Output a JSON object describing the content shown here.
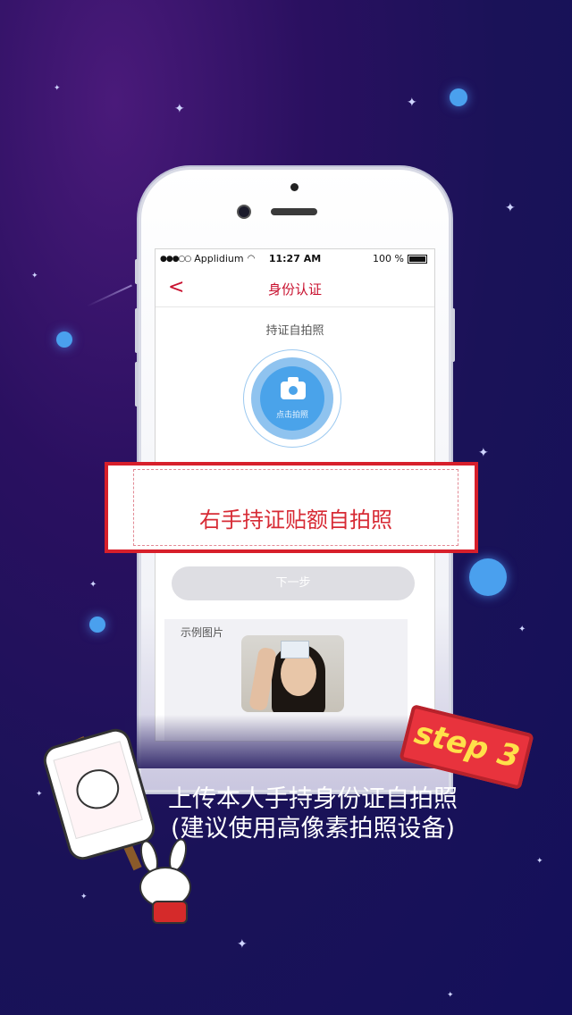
{
  "status_bar": {
    "carrier": "Applidium",
    "time": "11:27 AM",
    "battery": "100 %"
  },
  "nav": {
    "back_label": "<",
    "title": "身份认证"
  },
  "section": {
    "title": "持证自拍照"
  },
  "capture": {
    "label": "点击拍照"
  },
  "buttons": {
    "next": "下一步"
  },
  "example": {
    "title": "示例图片"
  },
  "callout": {
    "text": "右手持证贴额自拍照"
  },
  "captions": {
    "line1": "上传本人手持身份证自拍照",
    "line2": "(建议使用高像素拍照设备)"
  },
  "badge": {
    "text": "step 3"
  },
  "colors": {
    "accent_red": "#c8102e",
    "capture_blue": "#4aa3ea",
    "badge_red": "#e8333d",
    "badge_text": "#ffe14a"
  }
}
